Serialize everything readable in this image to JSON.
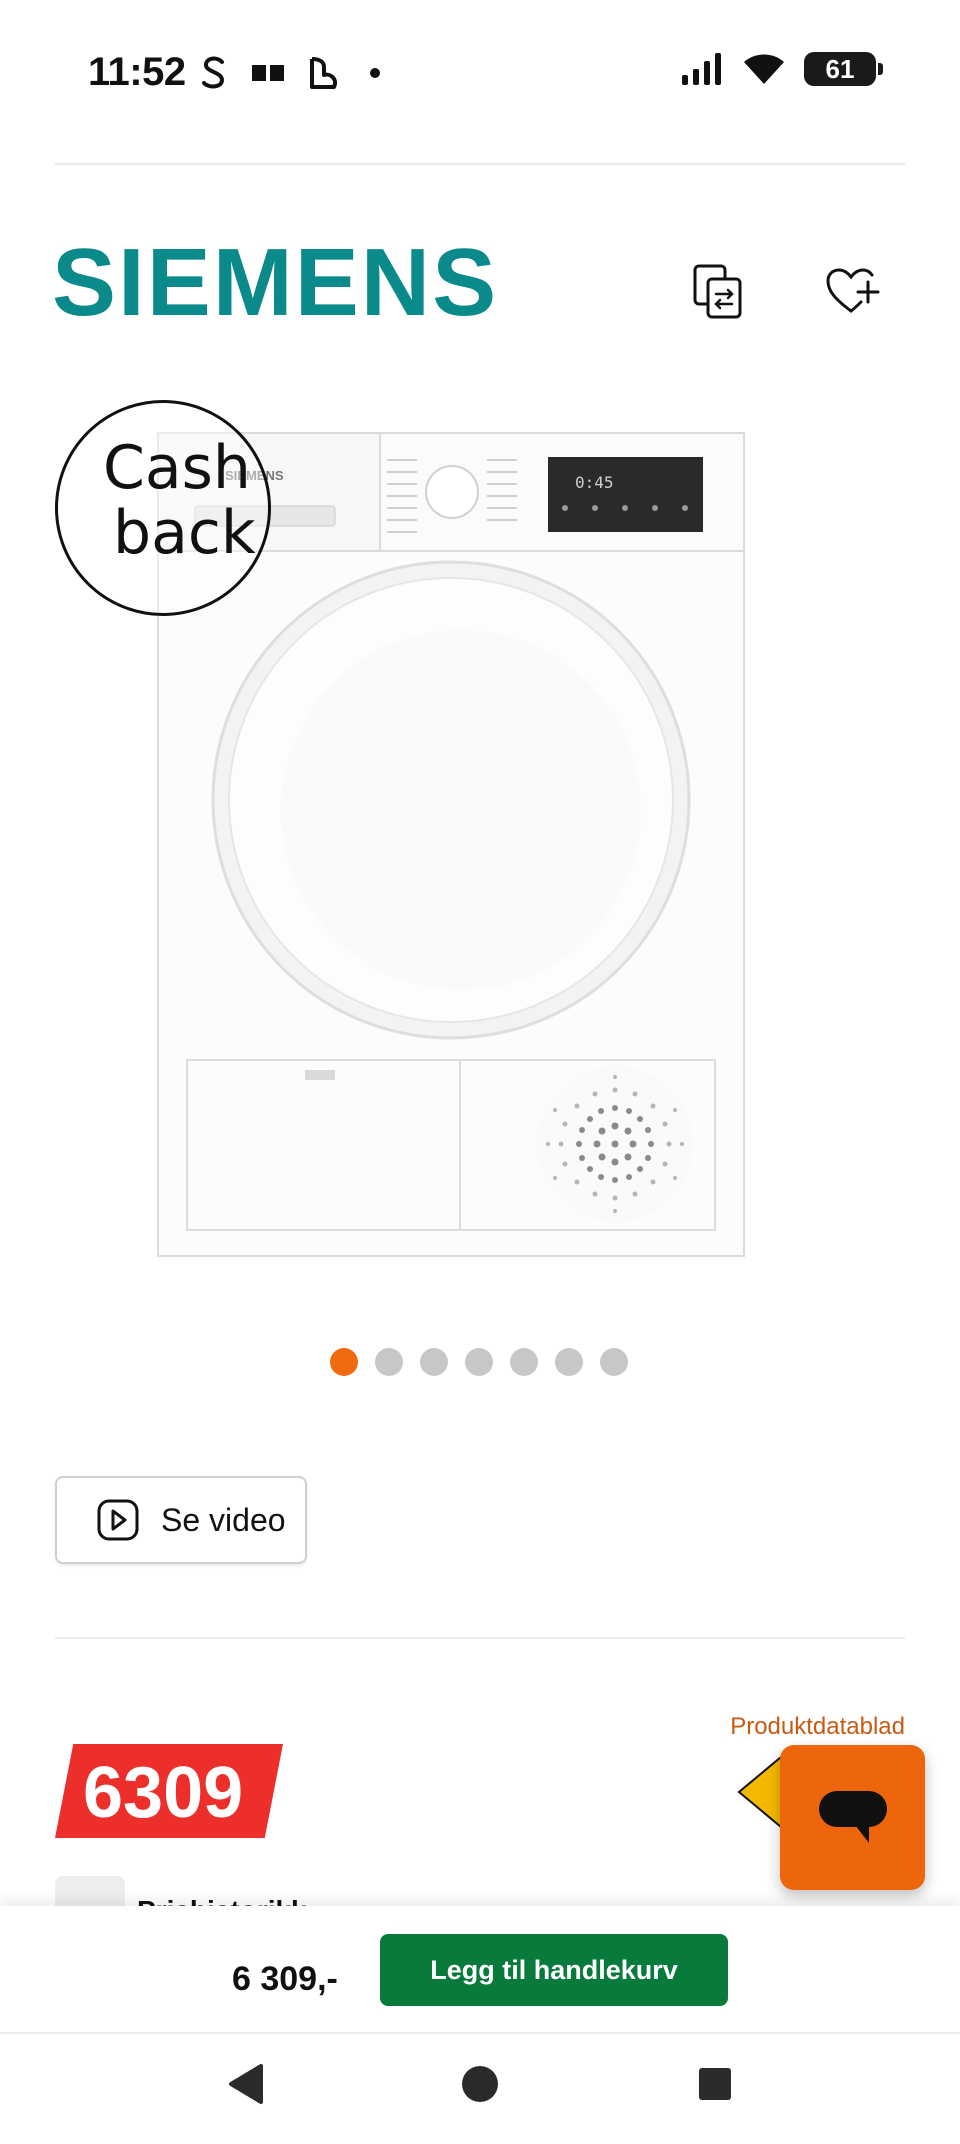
{
  "status_bar": {
    "time": "11:52",
    "battery": "61"
  },
  "header": {
    "brand": "SIEMENS",
    "brand_color": "#0b8a8c",
    "icons": [
      "compare-icon",
      "heart-plus-icon"
    ]
  },
  "product": {
    "badge_line1": "Cash",
    "badge_line2": "back",
    "image_count": 7,
    "active_image": 1
  },
  "video": {
    "label": "Se video"
  },
  "price_section": {
    "price": "6309",
    "price_tag_color": "#ec2f2a",
    "datasheet_link": "Produktdatablad",
    "price_history": "Prishistorikk"
  },
  "sticky_bar": {
    "price": "6 309,-",
    "add_to_cart": "Legg til handlekurv",
    "button_color": "#087a3c"
  },
  "chat": {
    "color": "#ee660b",
    "icon": "chat-bubble-icon"
  },
  "nav_bar": {
    "icons": [
      "back-icon",
      "home-icon",
      "recents-icon"
    ]
  }
}
